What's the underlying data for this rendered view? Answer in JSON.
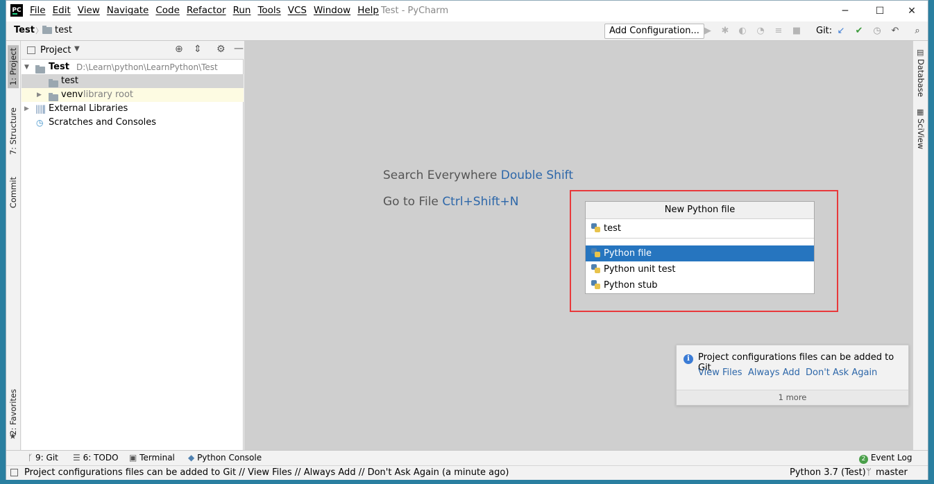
{
  "window": {
    "title": "Test - PyCharm",
    "logo_text": "PC",
    "controls": [
      "─",
      "☐",
      "✕"
    ]
  },
  "menu": [
    "File",
    "Edit",
    "View",
    "Navigate",
    "Code",
    "Refactor",
    "Run",
    "Tools",
    "VCS",
    "Window",
    "Help"
  ],
  "breadcrumb": {
    "project": "Test",
    "separator": "〉",
    "folder": "test"
  },
  "toolbar": {
    "add_configuration": "Add Configuration...",
    "git_label": "Git:"
  },
  "left_tabs": {
    "project": "1: Project",
    "structure": "7: Structure",
    "commit": "Commit",
    "favorites": "2: Favorites"
  },
  "right_tabs": {
    "database": "Database",
    "sciview": "SciView"
  },
  "project_panel": {
    "title": "Project",
    "tree": {
      "root_name": "Test",
      "root_path": "D:\\Learn\\python\\LearnPython\\Test",
      "child_test": "test",
      "venv_name": "venv",
      "venv_tag": "library root",
      "external_libraries": "External Libraries",
      "scratches": "Scratches and Consoles"
    }
  },
  "editor": {
    "hint_search_text": "Search Everywhere",
    "hint_search_shortcut": "Double Shift",
    "hint_goto_text": "Go to File",
    "hint_goto_shortcut": "Ctrl+Shift+N"
  },
  "popup": {
    "title": "New Python file",
    "input_value": "test",
    "items": [
      "Python file",
      "Python unit test",
      "Python stub"
    ],
    "selected_index": 0
  },
  "notification": {
    "message": "Project configurations files can be added to Git",
    "actions": [
      "View Files",
      "Always Add",
      "Don't Ask Again"
    ],
    "more": "1 more"
  },
  "bottom_tools": {
    "git": "9: Git",
    "todo": "6: TODO",
    "terminal": "Terminal",
    "python_console": "Python Console",
    "event_log": "Event Log",
    "event_count": "2"
  },
  "status": {
    "message": "Project configurations files can be added to Git // View Files // Always Add // Don't Ask Again (a minute ago)",
    "interpreter": "Python 3.7 (Test)",
    "branch": "master"
  },
  "colors": {
    "accent": "#2675bf",
    "link": "#2d67a9",
    "highlight_box": "#e8393b",
    "venv_row_bg": "#fdfbe2",
    "selected_tree_row": "#d5d5d5"
  }
}
